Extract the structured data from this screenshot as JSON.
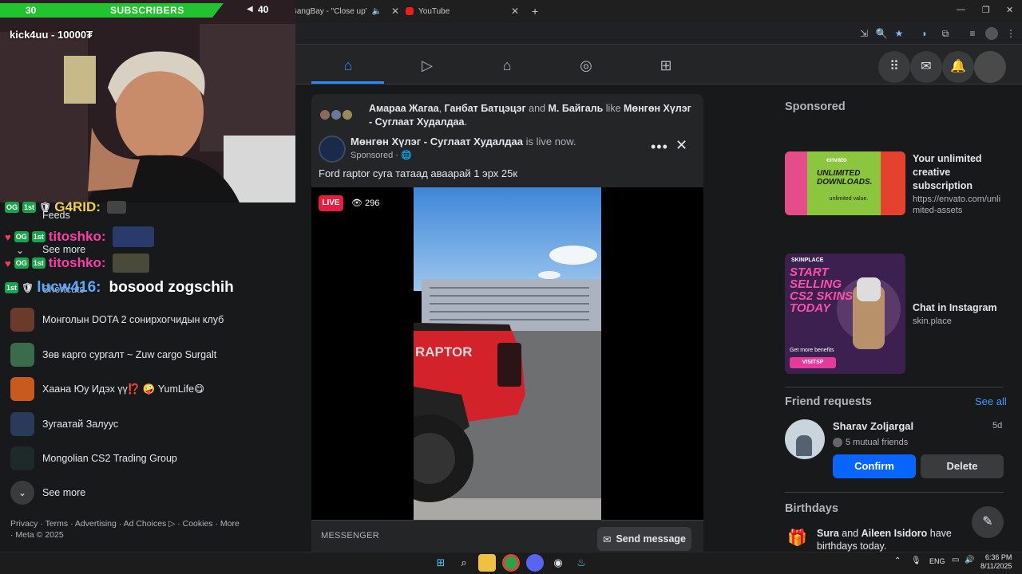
{
  "browser": {
    "tabs": [
      {
        "label": "GangBay - \"Close up\" ft Er"
      },
      {
        "label": "YouTube"
      }
    ]
  },
  "stream_overlay": {
    "sub_count": "30",
    "sub_label": "SUBSCRIBERS",
    "viewers": "40",
    "donation": "kick4uu - 10000₮",
    "chat": [
      {
        "user": "G4RID:",
        "color": "#f7d23b"
      },
      {
        "user": "titoshko:",
        "color": "#ff3da8"
      },
      {
        "user": "titoshko:",
        "color": "#ff3da8"
      },
      {
        "user": "lucw416:",
        "color": "#5aa8ff",
        "message": "bosood zogschih"
      }
    ]
  },
  "sidebar": {
    "feeds_label": "Feeds",
    "see_more_top": "See more",
    "shortcuts_label": "Shortcuts",
    "groups": [
      {
        "label": "Монголын DOTA 2 сонирхогчидын клуб",
        "color": "#6b3a2a"
      },
      {
        "label": "Зөв карго сургалт ~ Zuw cargo Surgalt",
        "color": "#3a6b4a"
      },
      {
        "label": "Хаана Юу Идэх үү⁉️ 🤪 YumLife😋",
        "color": "#c85a1e"
      },
      {
        "label": "Зугаатай Залуус",
        "color": "#2a3a5a"
      },
      {
        "label": "Mongolian CS2 Trading Group",
        "color": "#1e2a2a"
      }
    ],
    "see_more": "See more",
    "footer": "Privacy · Terms · Advertising · Ad Choices ▷ · Cookies · More · Meta © 2025"
  },
  "post": {
    "liker1": "Амараа Жагаа",
    "liker2": "Ганбат Батцэцэг",
    "and": "and",
    "liker3": "М. Байгаль",
    "like_word": "like",
    "liked_page": "Мөнгөн Хүлэг - Суглаат Худалдаа",
    "page_name": "Мөнгөн Хүлэг - Суглаат Худалдаа",
    "live_now": "is live now.",
    "sponsored": "Sponsored · ",
    "text": "Ford raptor суга татаад аваарай 1 эрх 25к",
    "live_label": "LIVE",
    "viewer_count": "296",
    "messenger_label": "MESSENGER",
    "send_message": "Send message"
  },
  "right": {
    "sponsored_title": "Sponsored",
    "ads": [
      {
        "title": "Your unlimited creative subscription",
        "url": "https://envato.com/unlimited-assets",
        "img_text1": "envato",
        "img_text2": "UNLIMITED DOWNLOADS.",
        "img_text3": "unlimited value."
      },
      {
        "title": "Chat in Instagram",
        "url": "skin.place",
        "img_text1": "SKINPLACE",
        "img_text2": "START SELLING CS2 SKINS TODAY",
        "img_text3": "Get more benefits",
        "img_text4": "VISITSP"
      }
    ],
    "friend_requests_title": "Friend requests",
    "see_all": "See all",
    "request": {
      "name": "Sharav Zoljargal",
      "time": "5d",
      "mutual": "5 mutual friends",
      "confirm": "Confirm",
      "delete": "Delete"
    },
    "birthdays_title": "Birthdays",
    "birthday_text_1": "Sura",
    "birthday_and": "and",
    "birthday_text_2": "Aileen Isidoro",
    "birthday_text_3": "have birthdays today."
  },
  "taskbar": {
    "time": "6:36 PM",
    "date": "8/11/2025",
    "lang": "ENG"
  }
}
